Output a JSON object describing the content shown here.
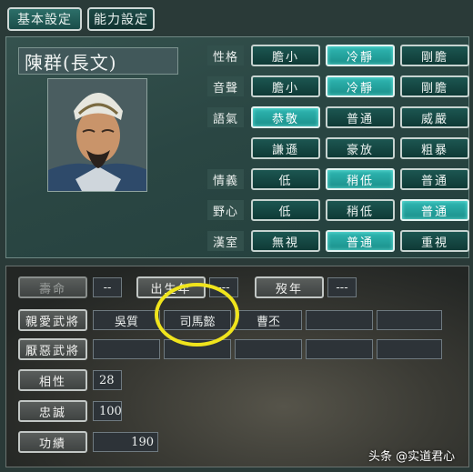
{
  "tabs": [
    {
      "label": "基本設定",
      "active": true
    },
    {
      "label": "能力設定",
      "active": false
    }
  ],
  "officer": {
    "name": "陳群(長文)"
  },
  "traits": [
    {
      "label": "性格",
      "options": [
        "膽小",
        "冷靜",
        "剛膽"
      ],
      "selected": 1
    },
    {
      "label": "音聲",
      "options": [
        "膽小",
        "冷靜",
        "剛膽"
      ],
      "selected": 1
    },
    {
      "label": "語氣",
      "options": [
        "恭敬",
        "普通",
        "威嚴"
      ],
      "selected": 0
    },
    {
      "label": "",
      "options": [
        "謙遜",
        "豪放",
        "粗暴"
      ],
      "selected": -1
    },
    {
      "label": "情義",
      "options": [
        "低",
        "稍低",
        "普通"
      ],
      "selected": 1
    },
    {
      "label": "野心",
      "options": [
        "低",
        "稍低",
        "普通"
      ],
      "selected": 2
    },
    {
      "label": "漢室",
      "options": [
        "無視",
        "普通",
        "重視"
      ],
      "selected": 1
    }
  ],
  "life": {
    "lifespan_label": "壽命",
    "lifespan_value": "--",
    "birth_label": "出生年",
    "birth_value": "---",
    "death_label": "歿年",
    "death_value": "---"
  },
  "favored": {
    "label": "親愛武將",
    "names": [
      "吳質",
      "司馬懿",
      "曹丕",
      "",
      ""
    ]
  },
  "disliked": {
    "label": "厭惡武將",
    "names": [
      "",
      "",
      "",
      "",
      ""
    ]
  },
  "stats": [
    {
      "label": "相性",
      "value": "28"
    },
    {
      "label": "忠誠",
      "value": "100"
    },
    {
      "label": "功績",
      "value": "190"
    }
  ],
  "watermark": "头条 @实道君心",
  "colors": {
    "selected_option": "#2fb7b2",
    "highlight_circle": "#f0e41c"
  }
}
